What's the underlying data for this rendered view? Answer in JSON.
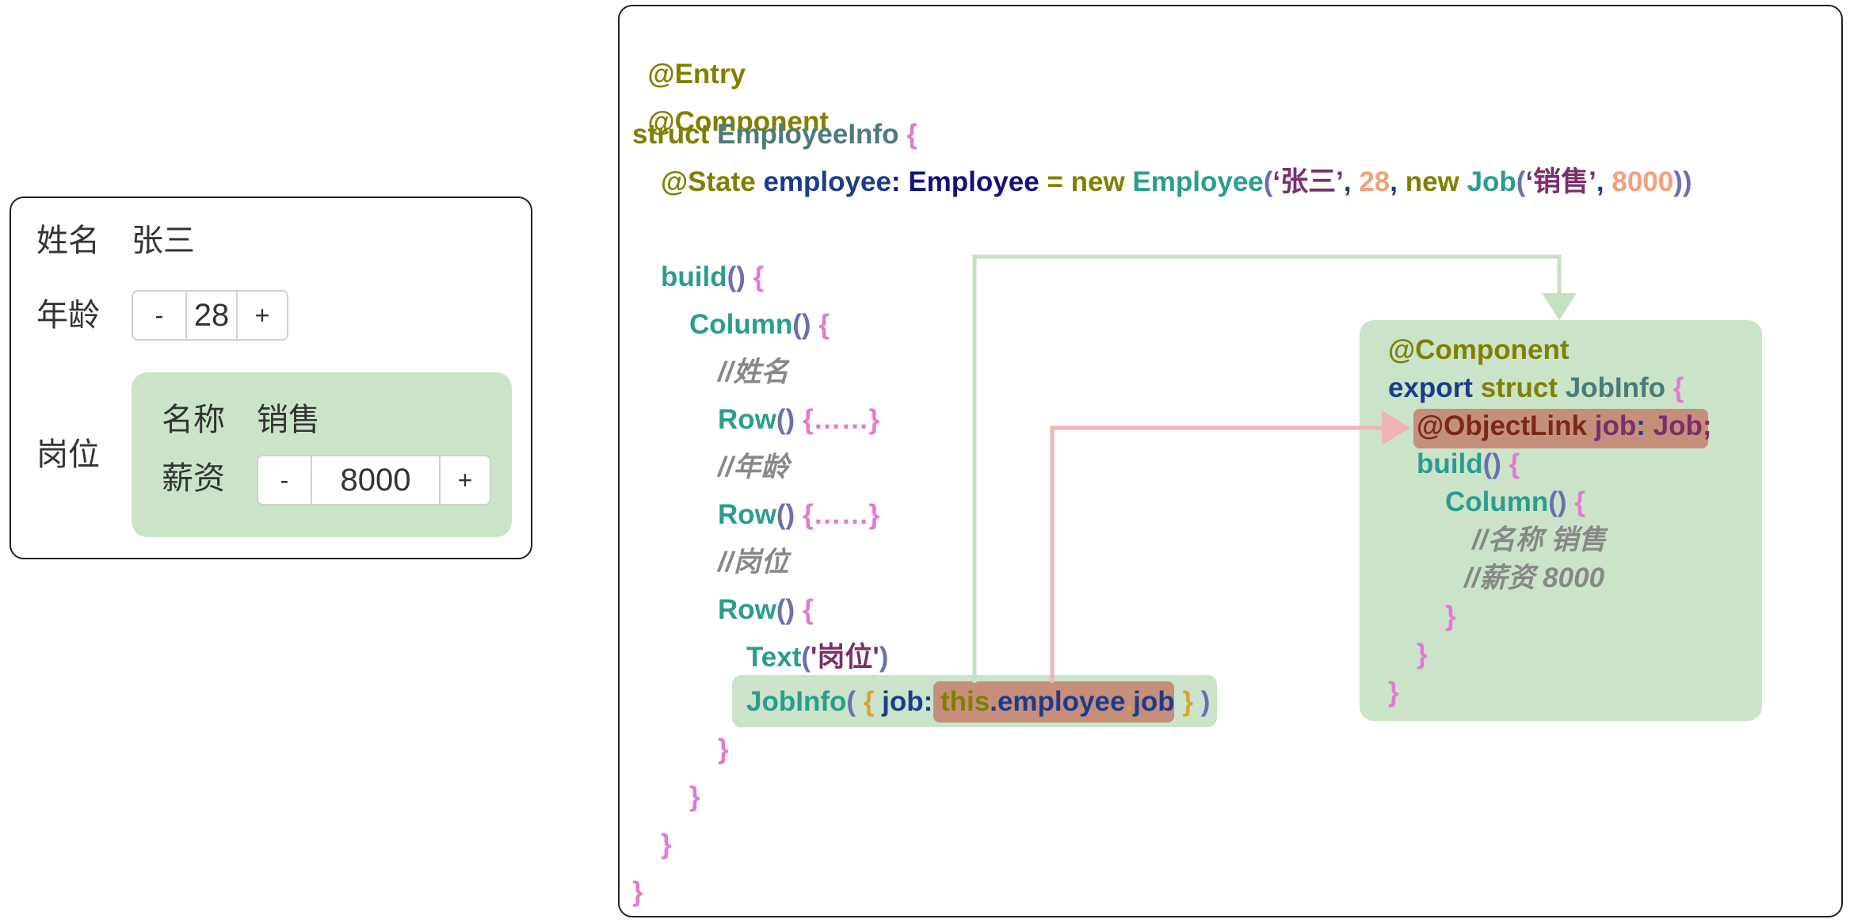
{
  "preview": {
    "name_label": "姓名",
    "name_value": "张三",
    "age_label": "年龄",
    "age_stepper": {
      "minus": "-",
      "value": "28",
      "plus": "+"
    },
    "job_label": "岗位",
    "job": {
      "title_label": "名称",
      "title_value": "销售",
      "salary_label": "薪资",
      "salary_stepper": {
        "minus": "-",
        "value": "8000",
        "plus": "+"
      }
    }
  },
  "code": {
    "entry": "@Entry",
    "component": "@Component",
    "struct_kw": "struct",
    "struct_name": "EmployeeInfo",
    "brace_open": "{",
    "brace_close": "}",
    "state_decorator": "@State",
    "state_var": "employee",
    "colon": ":",
    "state_type": "Employee",
    "eq": "=",
    "new_kw": "new",
    "ctor_employee": "Employee",
    "paren_open": "(",
    "paren_close": ")",
    "paren_close2": "))",
    "arg_name": "‘张三’",
    "comma": ",",
    "arg_age": "28",
    "ctor_job": "Job",
    "arg_job_title": "‘销售’",
    "arg_salary": "8000",
    "build": "build",
    "parens": "()",
    "column": "Column",
    "comment_name": "//姓名",
    "row": "Row",
    "ellipsis_block": "{……}",
    "comment_age": "//年龄",
    "comment_job": "//岗位",
    "text_fn": "Text",
    "text_arg": "'岗位'",
    "jobinfo_call": "JobInfo",
    "job_key": "job",
    "this_kw": "this",
    "dot": ".",
    "employee_prop": "employee",
    "job_prop": "job"
  },
  "sub_component": {
    "decorator": "@Component",
    "export_kw": "export",
    "struct_kw": "struct",
    "name": "JobInfo",
    "brace_open": "{",
    "brace_close": "}",
    "objectlink": "@ObjectLink",
    "job_var": "job",
    "colon": ":",
    "job_type": "Job;",
    "build": "build",
    "parens": "()",
    "column": "Column",
    "comment_title": "//名称 销售",
    "comment_salary": "//薪资 8000"
  },
  "colors": {
    "highlight_green": "#cbe4c9",
    "highlight_red": "#c58f7c",
    "arrow_green": "#cbe4c9",
    "arrow_red": "#f0b4b4"
  }
}
